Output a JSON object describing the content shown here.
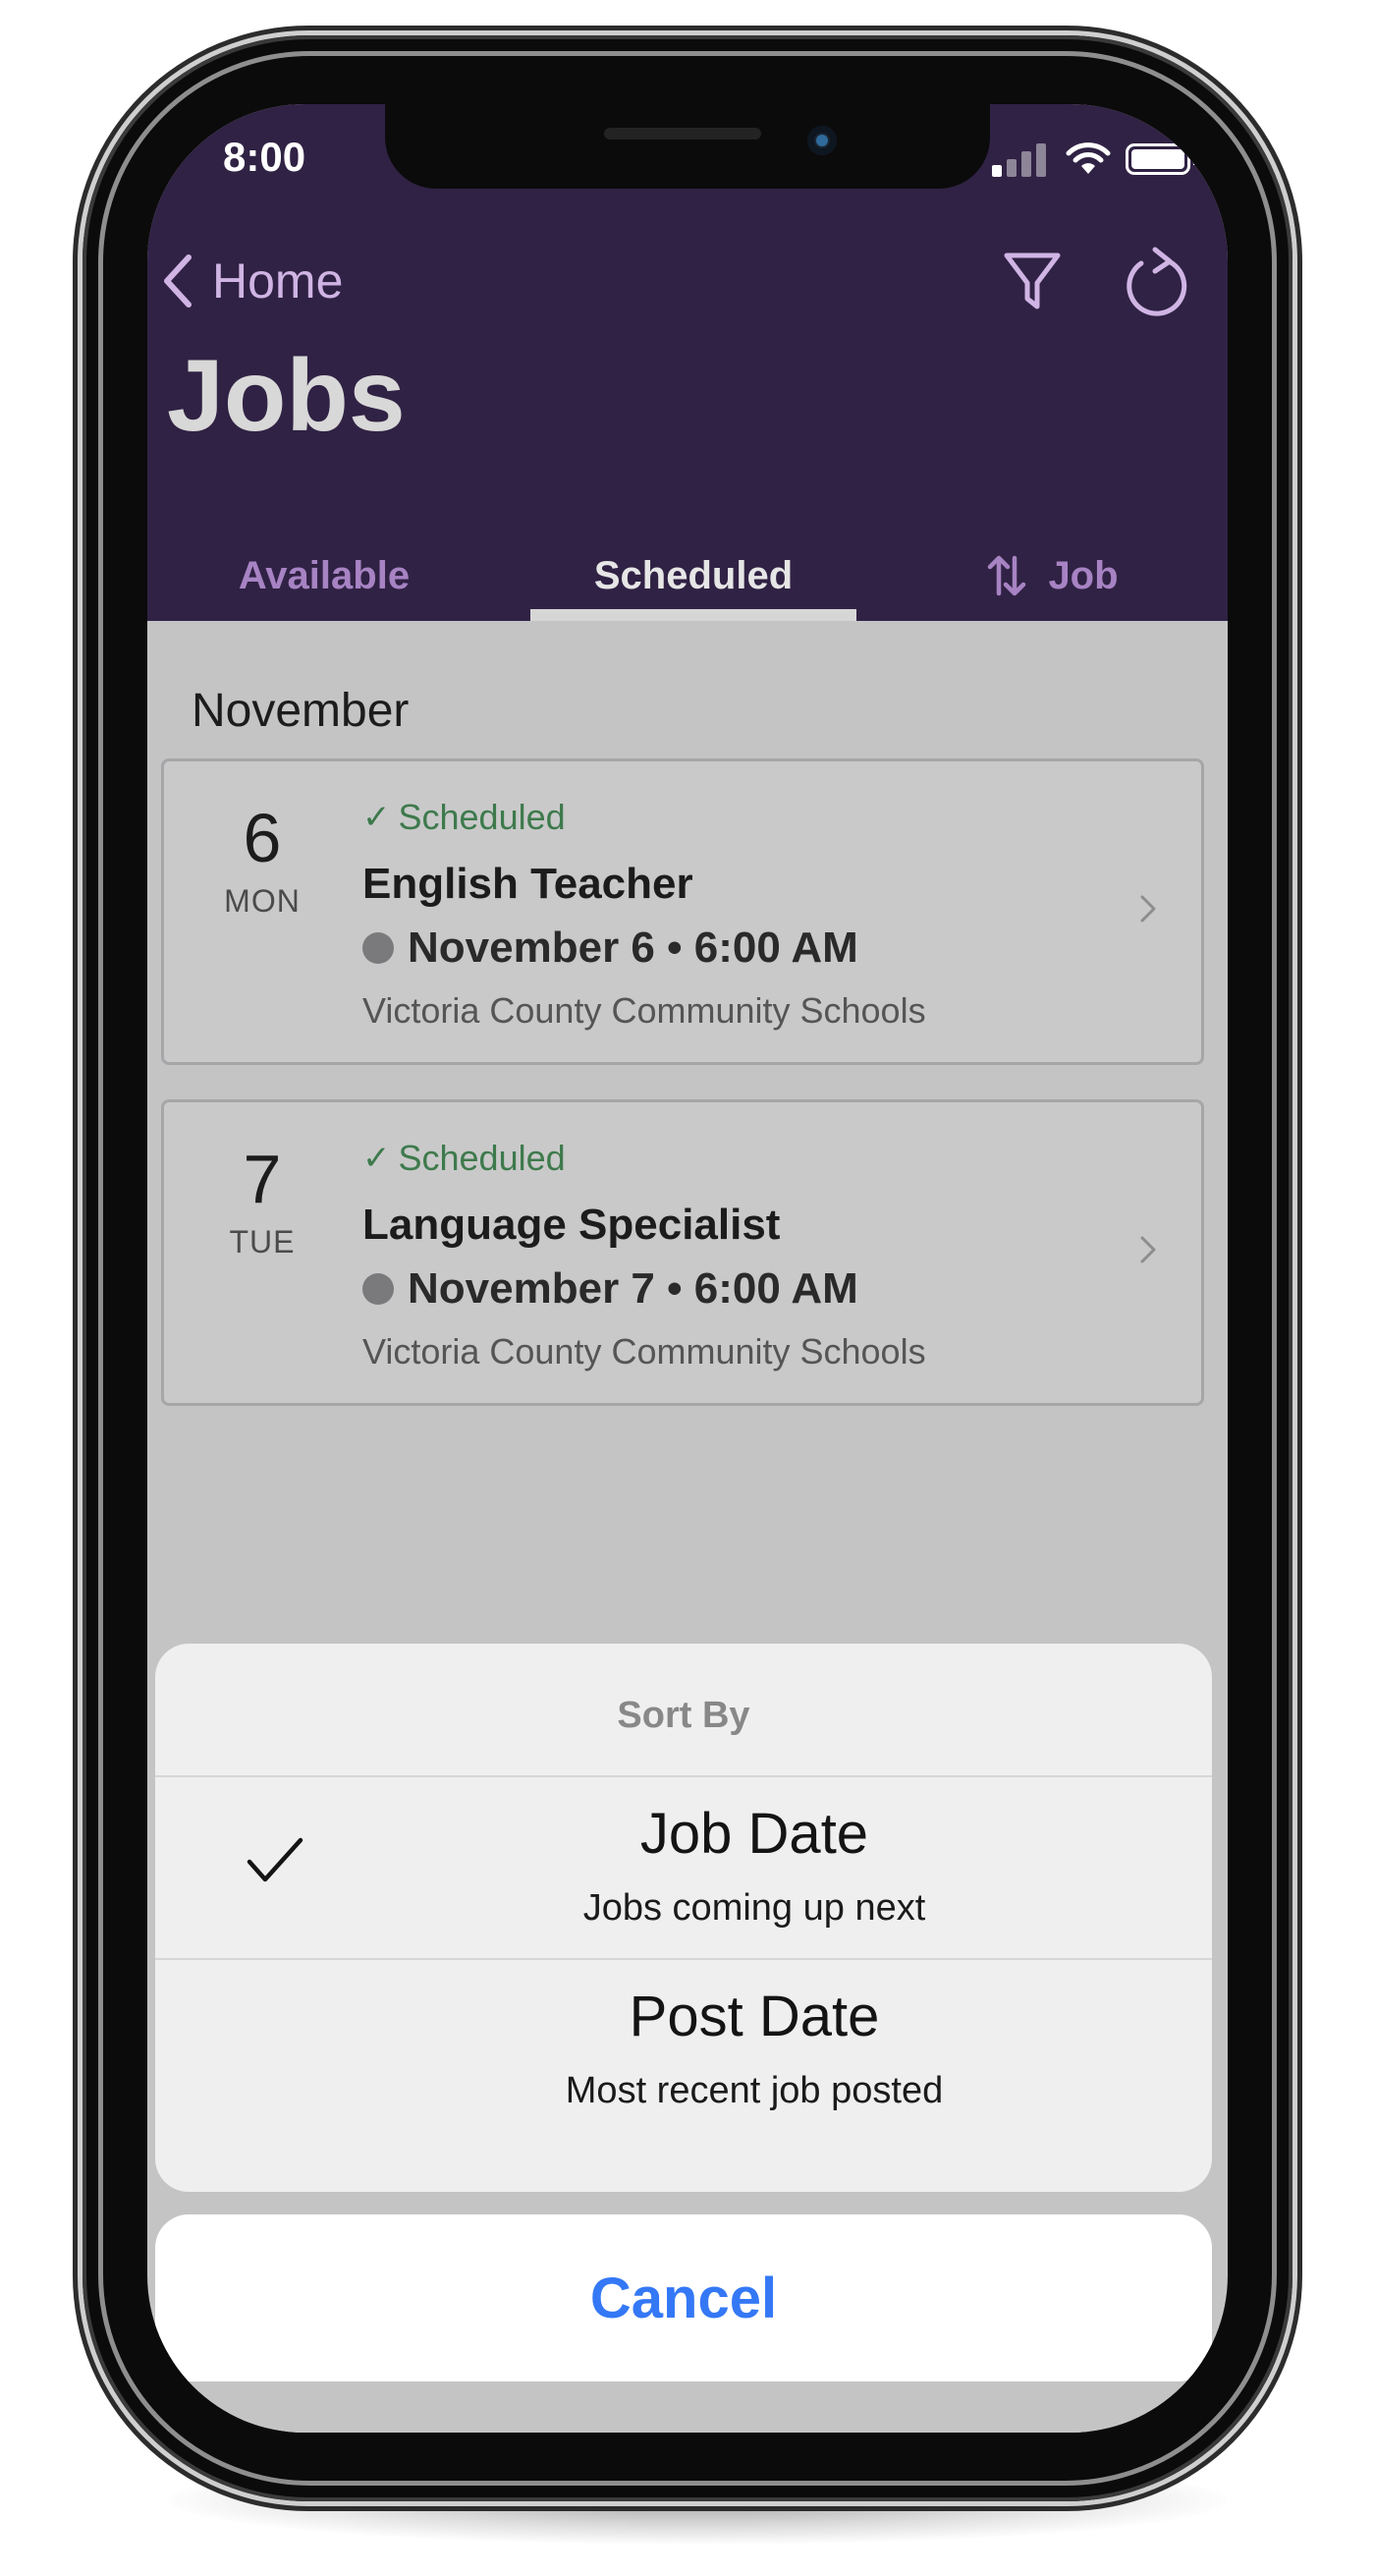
{
  "status_bar": {
    "time": "8:00"
  },
  "header": {
    "back_label": "Home",
    "title": "Jobs",
    "tabs": [
      {
        "label": "Available"
      },
      {
        "label": "Scheduled"
      },
      {
        "label": "Job"
      }
    ]
  },
  "list": {
    "month": "November",
    "jobs": [
      {
        "day": "6",
        "weekday": "MON",
        "status": "Scheduled",
        "title": "English Teacher",
        "datetime": "November 6 • 6:00 AM",
        "school": "Victoria County Community Schools"
      },
      {
        "day": "7",
        "weekday": "TUE",
        "status": "Scheduled",
        "title": "Language Specialist",
        "datetime": "November 7 • 6:00 AM",
        "school": "Victoria County Community Schools"
      }
    ]
  },
  "sort_sheet": {
    "title": "Sort By",
    "options": [
      {
        "title": "Job Date",
        "subtitle": "Jobs coming up next",
        "selected": true
      },
      {
        "title": "Post Date",
        "subtitle": "Most recent job posted",
        "selected": false
      }
    ],
    "cancel_label": "Cancel"
  },
  "colors": {
    "header_bg": "#302244",
    "tab_inactive": "#a783c3",
    "status_green": "#3e7a4c",
    "cancel_blue": "#3478f6"
  }
}
